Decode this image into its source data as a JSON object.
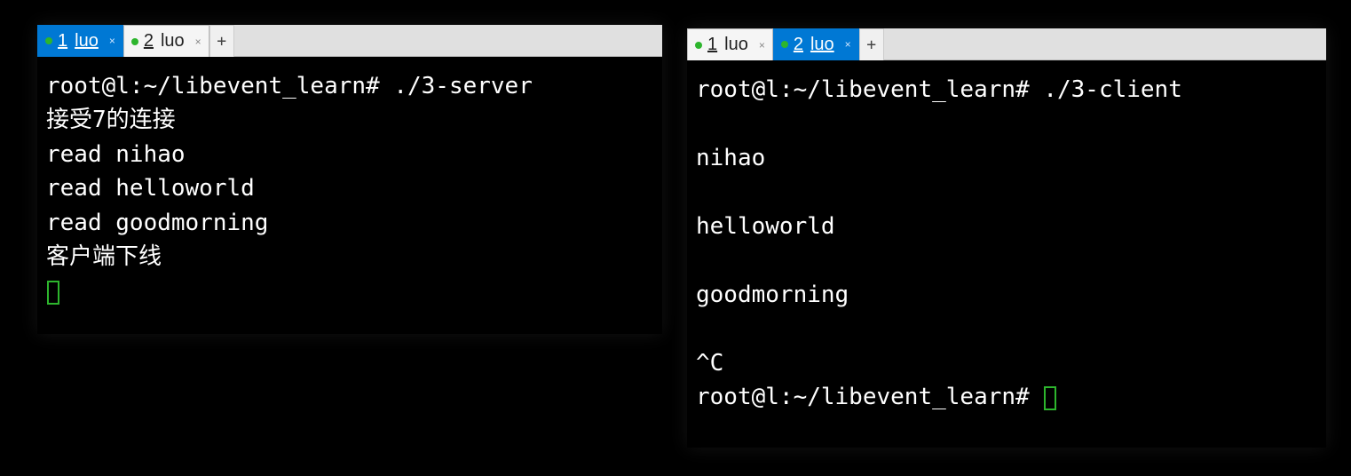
{
  "left": {
    "tabs": [
      {
        "num": "1",
        "label": "luo",
        "active": true
      },
      {
        "num": "2",
        "label": "luo",
        "active": false
      }
    ],
    "newTab": "+",
    "lines": [
      "root@l:~/libevent_learn# ./3-server",
      "接受7的连接",
      "read nihao",
      "read helloworld",
      "read goodmorning",
      "客户端下线"
    ]
  },
  "right": {
    "tabs": [
      {
        "num": "1",
        "label": "luo",
        "active": false
      },
      {
        "num": "2",
        "label": "luo",
        "active": true
      }
    ],
    "newTab": "+",
    "lines": [
      "root@l:~/libevent_learn# ./3-client",
      "",
      "nihao",
      "",
      "helloworld",
      "",
      "goodmorning",
      "",
      "^C"
    ],
    "promptAfter": "root@l:~/libevent_learn# "
  }
}
